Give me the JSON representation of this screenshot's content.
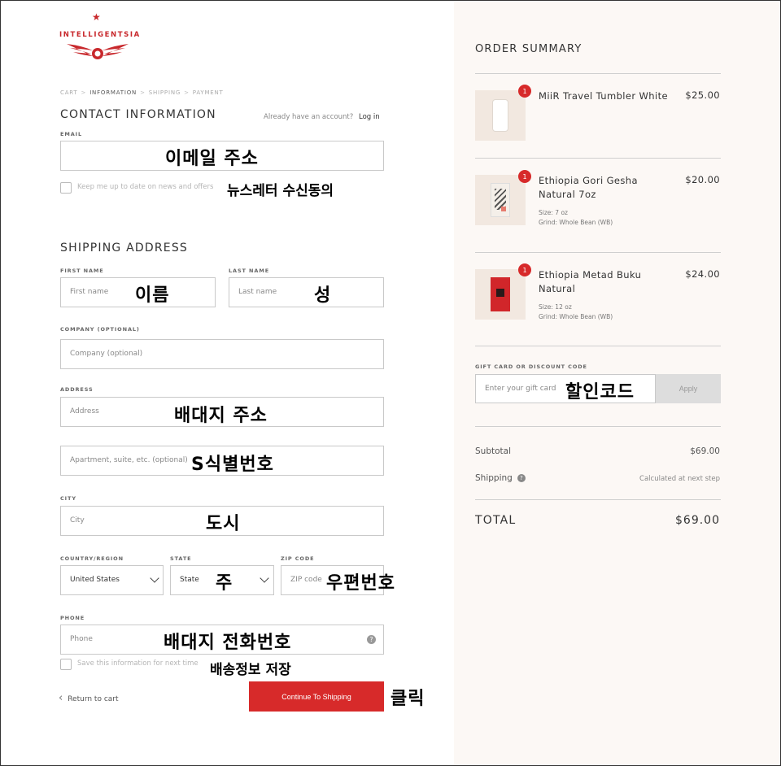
{
  "brand": {
    "name": "INTELLIGENTSIA",
    "accent_color": "#d72a2a"
  },
  "breadcrumb": {
    "items": [
      "CART",
      "INFORMATION",
      "SHIPPING",
      "PAYMENT"
    ],
    "separator": ">"
  },
  "contact": {
    "title": "CONTACT INFORMATION",
    "account_prompt": "Already have an account?",
    "login_link": "Log in",
    "email_label": "EMAIL",
    "email_annotation": "이메일 주소",
    "newsletter_label": "Keep me up to date on news and offers",
    "newsletter_annotation": "뉴스레터 수신동의"
  },
  "shipping": {
    "title": "SHIPPING ADDRESS",
    "first_name_label": "FIRST NAME",
    "first_name_placeholder": "First name",
    "first_name_annotation": "이름",
    "last_name_label": "LAST NAME",
    "last_name_placeholder": "Last name",
    "last_name_annotation": "성",
    "company_label": "COMPANY (OPTIONAL)",
    "company_placeholder": "Company (optional)",
    "address_label": "ADDRESS",
    "address_placeholder": "Address",
    "address_annotation": "배대지 주소",
    "apartment_placeholder": "Apartment, suite, etc. (optional)",
    "apartment_annotation": "S식별번호",
    "city_label": "CITY",
    "city_placeholder": "City",
    "city_annotation": "도시",
    "country_label": "COUNTRY/REGION",
    "country_value": "United States",
    "state_label": "STATE",
    "state_value": "State",
    "state_annotation": "주",
    "zip_label": "ZIP CODE",
    "zip_placeholder": "ZIP code",
    "zip_annotation": "우편번호",
    "phone_label": "PHONE",
    "phone_placeholder": "Phone",
    "phone_annotation": "배대지 전화번호",
    "save_info_label": "Save this information for next time",
    "save_info_annotation": "배송정보 저장",
    "return_link": "Return to cart",
    "continue_button": "Continue To Shipping",
    "continue_annotation": "클릭"
  },
  "summary": {
    "title": "ORDER SUMMARY",
    "items": [
      {
        "quantity": "1",
        "name": "MiiR Travel Tumbler White",
        "price": "$25.00"
      },
      {
        "quantity": "1",
        "name": "Ethiopia Gori Gesha Natural 7oz",
        "price": "$20.00",
        "size": "Size: 7 oz",
        "grind": "Grind: Whole Bean (WB)"
      },
      {
        "quantity": "1",
        "name": "Ethiopia Metad Buku Natural",
        "price": "$24.00",
        "size": "Size: 12 oz",
        "grind": "Grind: Whole Bean (WB)"
      }
    ],
    "gift_label": "GIFT CARD OR DISCOUNT CODE",
    "gift_placeholder": "Enter your gift card",
    "gift_annotation": "할인코드",
    "apply_button": "Apply",
    "subtotal_label": "Subtotal",
    "subtotal_value": "$69.00",
    "shipping_label": "Shipping",
    "shipping_value": "Calculated at next step",
    "total_label": "TOTAL",
    "total_value": "$69.00"
  }
}
